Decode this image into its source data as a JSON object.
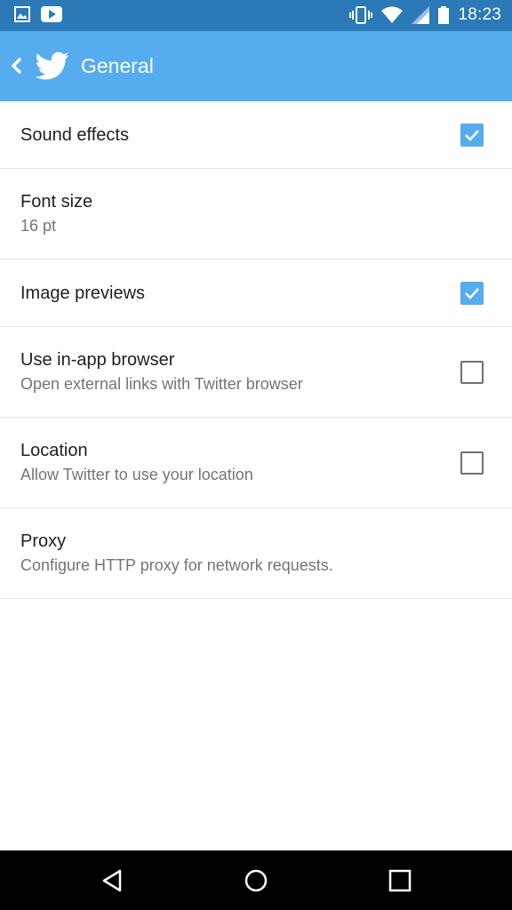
{
  "status_bar": {
    "time": "18:23",
    "icons": [
      "image-notification-icon",
      "youtube-notification-icon",
      "vibrate-icon",
      "wifi-icon",
      "cell-signal-icon",
      "battery-icon"
    ]
  },
  "app_bar": {
    "title": "General",
    "back_icon": "chevron-left-icon",
    "logo_icon": "twitter-bird-icon",
    "color": "#55acee"
  },
  "settings": [
    {
      "title": "Sound effects",
      "subtitle": "",
      "checkbox": true,
      "checked": true
    },
    {
      "title": "Font size",
      "subtitle": "16 pt",
      "checkbox": false,
      "checked": false
    },
    {
      "title": "Image previews",
      "subtitle": "",
      "checkbox": true,
      "checked": true
    },
    {
      "title": "Use in-app browser",
      "subtitle": "Open external links with Twitter browser",
      "checkbox": true,
      "checked": false
    },
    {
      "title": "Location",
      "subtitle": "Allow Twitter to use your location",
      "checkbox": true,
      "checked": false
    },
    {
      "title": "Proxy",
      "subtitle": "Configure HTTP proxy for network requests.",
      "checkbox": false,
      "checked": false
    }
  ],
  "nav_bar": {
    "icons": [
      "nav-back-icon",
      "nav-home-icon",
      "nav-recents-icon"
    ]
  },
  "colors": {
    "status_bar": "#2b79b7",
    "accent": "#55acee",
    "title_text": "#212121",
    "subtitle_text": "#757575"
  }
}
